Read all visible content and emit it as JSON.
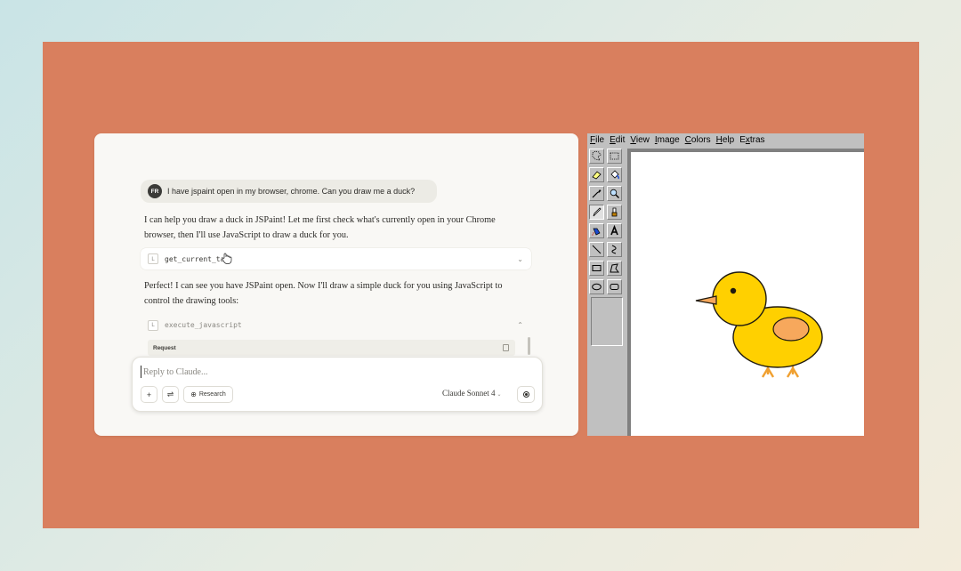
{
  "chat": {
    "user": {
      "avatar_initials": "FR",
      "message": "I have jspaint open in my browser, chrome. Can you draw me a duck?"
    },
    "assistant_1": "I can help you draw a duck in JSPaint! Let me first check what's currently open in your Chrome browser, then I'll use JavaScript to draw a duck for you.",
    "tool_call_1": {
      "badge": "L",
      "name": "get_current_tab",
      "chevron": "⌄"
    },
    "assistant_2": "Perfect! I can see you have JSPaint open. Now I'll draw a simple duck for you using JavaScript to control the drawing tools:",
    "tool_call_2": {
      "badge": "L",
      "name": "execute_javascript",
      "chevron": "⌃"
    },
    "request_label": "Request",
    "composer": {
      "placeholder": "Reply to Claude...",
      "plus_label": "+",
      "tune_label": "⇌",
      "research_icon": "⊕",
      "research_label": "Research",
      "model": "Claude Sonnet 4",
      "model_chevron": "⌄"
    }
  },
  "paint": {
    "menu": [
      "File",
      "Edit",
      "View",
      "Image",
      "Colors",
      "Help",
      "Extras"
    ],
    "tools": [
      "free-form-select",
      "rect-select",
      "eraser",
      "fill",
      "color-picker",
      "magnifier",
      "pencil",
      "brush",
      "airbrush",
      "text",
      "line",
      "curve",
      "rectangle",
      "polygon",
      "ellipse",
      "rounded-rectangle"
    ],
    "active_tool": "pencil",
    "duck_colors": {
      "body": "#ffd000",
      "wing": "#f7a85c",
      "beak": "#f7a85c",
      "feet": "#f0a030",
      "outline": "#1f1a10"
    }
  },
  "colors": {
    "stage": "#d97f5e",
    "chat_bg": "#f9f8f5",
    "paint_chrome": "#c0c0c0"
  }
}
